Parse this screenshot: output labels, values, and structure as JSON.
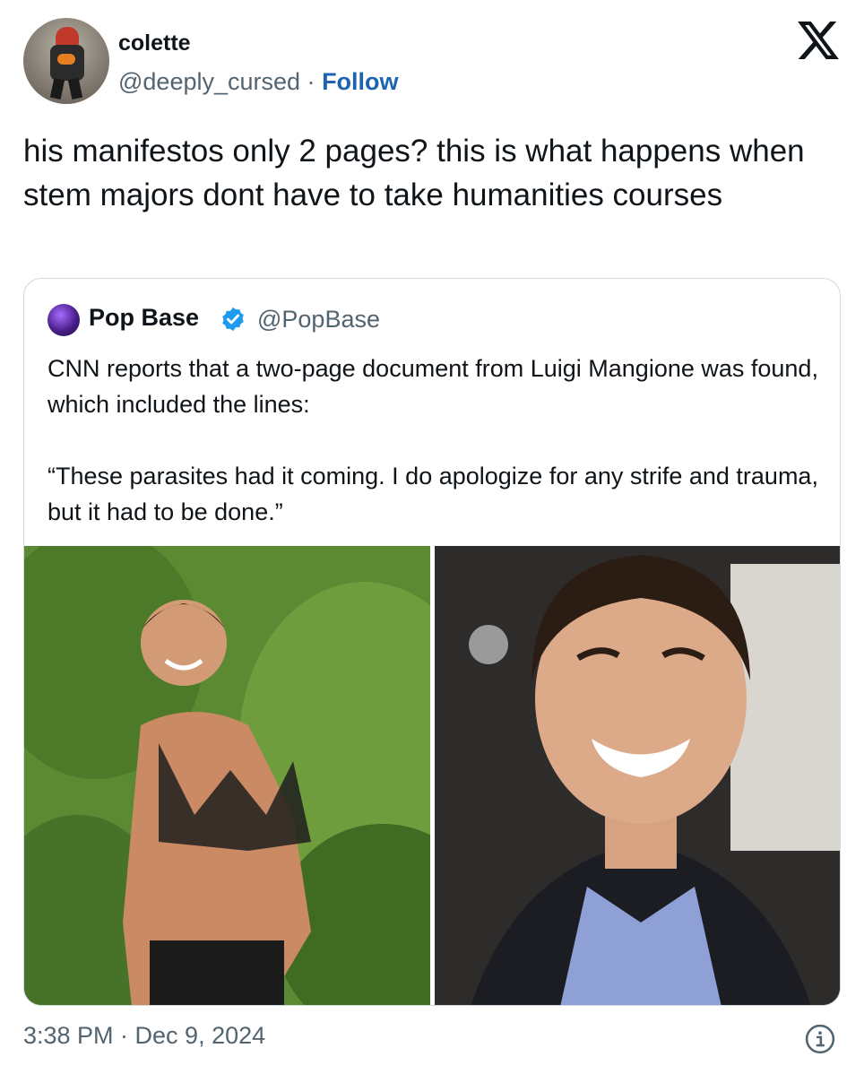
{
  "author": {
    "display_name": "colette",
    "handle": "@deeply_cursed",
    "separator": "·",
    "follow_label": "Follow"
  },
  "tweet": {
    "text": "his manifestos only 2 pages? this is what happens when stem majors dont have to take humanities courses"
  },
  "quoted": {
    "display_name": "Pop Base",
    "handle": "@PopBase",
    "text": "CNN reports that a two-page document from Luigi Mangione was found, which included the lines:\n\n“These parasites had it coming. I do apologize for any strife and trauma, but it had to be done.”",
    "verified_color": "#1d9bf0"
  },
  "footer": {
    "timestamp": "3:38 PM · Dec 9, 2024"
  },
  "icons": {
    "brand": "x-logo-icon",
    "info": "info-icon",
    "verified": "verified-badge-icon"
  },
  "colors": {
    "text_primary": "#0f1419",
    "text_secondary": "#536471",
    "link": "#1d64b0",
    "border": "#cfd9de"
  }
}
